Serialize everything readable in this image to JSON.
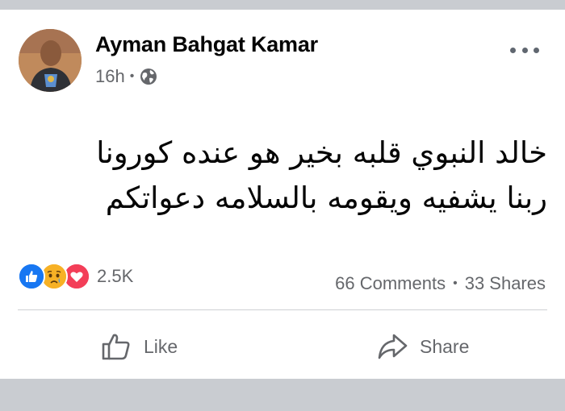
{
  "post": {
    "author": "Ayman Bahgat Kamar",
    "time": "16h",
    "separator": "•",
    "audience_icon": "globe-icon",
    "text_line1": "خالد النبوي قلبه بخير هو عنده كورونا",
    "text_line2": "ربنا يشفيه ويقومه بالسلامه دعواتكم",
    "reactions": {
      "icons": [
        "like-reaction-icon",
        "sad-reaction-icon",
        "love-reaction-icon"
      ],
      "count": "2.5K"
    },
    "comments": "66 Comments",
    "stats_separator": "•",
    "shares": "33 Shares"
  },
  "actions": {
    "like_label": "Like",
    "share_label": "Share"
  },
  "colors": {
    "like_blue": "#1877f2",
    "love_red": "#f33e58",
    "sad_yellow": "#f7b125",
    "muted_text": "#65676b"
  }
}
